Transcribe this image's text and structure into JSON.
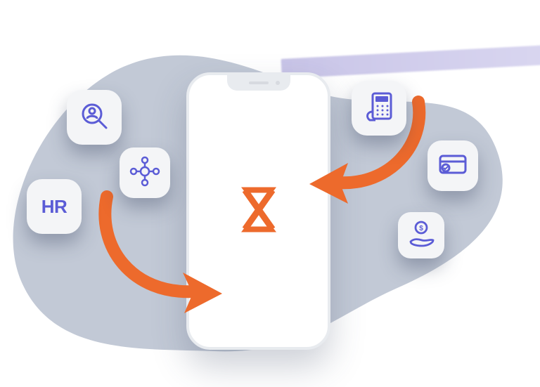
{
  "hero": {
    "hr_label": "HR",
    "icons": {
      "search_person": "search-person-icon",
      "people_network": "people-network-icon",
      "calculator": "calculator-icon",
      "card_check": "card-check-icon",
      "money_hand": "money-hand-icon",
      "hourglass": "hourglass-logo-icon"
    }
  }
}
